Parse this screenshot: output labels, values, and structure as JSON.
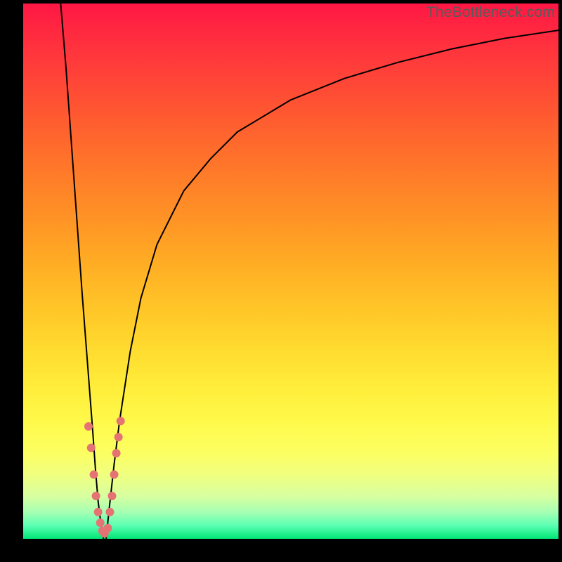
{
  "watermark": "TheBottleneck.com",
  "chart_data": {
    "type": "line",
    "title": "",
    "xlabel": "",
    "ylabel": "",
    "xlim": [
      0,
      100
    ],
    "ylim": [
      0,
      100
    ],
    "grid": false,
    "legend": false,
    "background_gradient": {
      "direction": "vertical",
      "stops": [
        {
          "pos": 0,
          "color": "#ff1744"
        },
        {
          "pos": 50,
          "color": "#ffab24"
        },
        {
          "pos": 80,
          "color": "#fff94a"
        },
        {
          "pos": 100,
          "color": "#00e676"
        }
      ]
    },
    "series": [
      {
        "name": "left-falling-branch",
        "x": [
          7,
          8,
          9,
          10,
          11,
          12,
          13,
          13.5,
          14,
          14.5,
          15
        ],
        "y": [
          100,
          88,
          74,
          60,
          46,
          33,
          20,
          13,
          7,
          3,
          0
        ]
      },
      {
        "name": "right-rising-branch",
        "x": [
          15.5,
          16,
          17,
          18,
          20,
          22,
          25,
          30,
          35,
          40,
          50,
          60,
          70,
          80,
          90,
          100
        ],
        "y": [
          0,
          5,
          14,
          22,
          35,
          45,
          55,
          65,
          71,
          76,
          82,
          86,
          89,
          91.5,
          93.5,
          95
        ]
      }
    ],
    "markers": {
      "name": "highlighted-points-near-minimum",
      "color": "#e57373",
      "points": [
        {
          "x": 12.2,
          "y": 21
        },
        {
          "x": 12.7,
          "y": 17
        },
        {
          "x": 13.2,
          "y": 12
        },
        {
          "x": 13.6,
          "y": 8
        },
        {
          "x": 14.0,
          "y": 5
        },
        {
          "x": 14.4,
          "y": 3
        },
        {
          "x": 14.8,
          "y": 1.5
        },
        {
          "x": 15.2,
          "y": 1
        },
        {
          "x": 15.8,
          "y": 2
        },
        {
          "x": 16.2,
          "y": 5
        },
        {
          "x": 16.6,
          "y": 8
        },
        {
          "x": 17.0,
          "y": 12
        },
        {
          "x": 17.4,
          "y": 16
        },
        {
          "x": 17.8,
          "y": 19
        },
        {
          "x": 18.2,
          "y": 22
        }
      ]
    }
  }
}
